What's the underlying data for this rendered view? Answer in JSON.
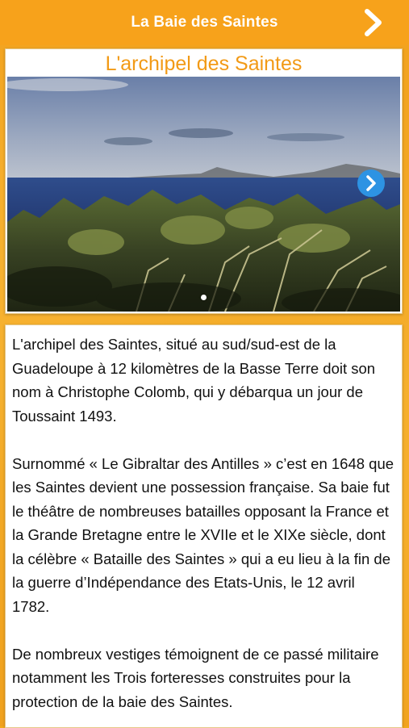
{
  "header": {
    "title": "La Baie des Saintes",
    "next_icon": "chevron-right-icon"
  },
  "gallery": {
    "title": "L'archipel des Saintes",
    "next_icon": "chevron-right-circle-icon",
    "page_count": 1,
    "active_page": 1
  },
  "article": {
    "paragraphs": [
      "L'archipel des Saintes, situé au sud/sud-est de la Guadeloupe à 12 kilomètres de la Basse Terre doit son nom à Christophe Colomb, qui y débarqua un jour de Toussaint 1493.",
      "Surnommé « Le Gibraltar des Antilles » c’est en 1648 que les Saintes devient une possession française. Sa baie fut le théâtre de nombreuses batailles opposant la France et la Grande Bretagne entre le XVIIe et le XIXe siècle, dont la célèbre « Bataille des Saintes » qui a eu lieu à la fin de la guerre d’Indépendance des Etats-Unis, le 12 avril 1782.",
      "De nombreux vestiges témoignent de ce passé militaire notamment les Trois forteresses construites pour la protection de la baie des Saintes."
    ]
  },
  "colors": {
    "brand_orange": "#f7a21b",
    "title_orange": "#f29a16",
    "accent_blue": "#2d93e3"
  }
}
